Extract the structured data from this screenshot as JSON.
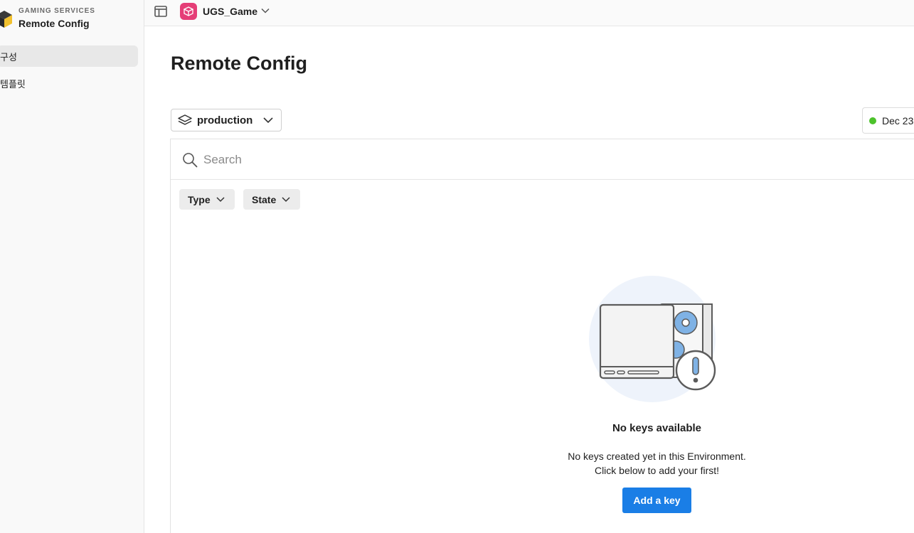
{
  "sidebar": {
    "kicker": "GAMING SERVICES",
    "title": "Remote Config",
    "items": [
      {
        "label": "구성",
        "active": true
      },
      {
        "label": "템플릿",
        "active": false
      }
    ]
  },
  "topbar": {
    "project_name": "UGS_Game",
    "project_color": "#e53e77"
  },
  "main": {
    "page_title": "Remote Config",
    "environment": "production",
    "last_updated": "Dec 23",
    "status_color": "#4cc22b",
    "search_placeholder": "Search",
    "filters": [
      {
        "label": "Type"
      },
      {
        "label": "State"
      }
    ],
    "empty_state": {
      "title": "No keys available",
      "line1": "No keys created yet in this Environment.",
      "line2": "Click below to add your first!",
      "button": "Add a key"
    },
    "accent_color": "#1a7ee6"
  },
  "icons": {
    "brand": "cube-logo-icon",
    "layout": "panel-layout-icon",
    "project": "cube-icon",
    "environment": "layers-icon",
    "search": "search-icon",
    "chevron": "chevron-down-icon",
    "illustration": "no-keys-illustration"
  }
}
